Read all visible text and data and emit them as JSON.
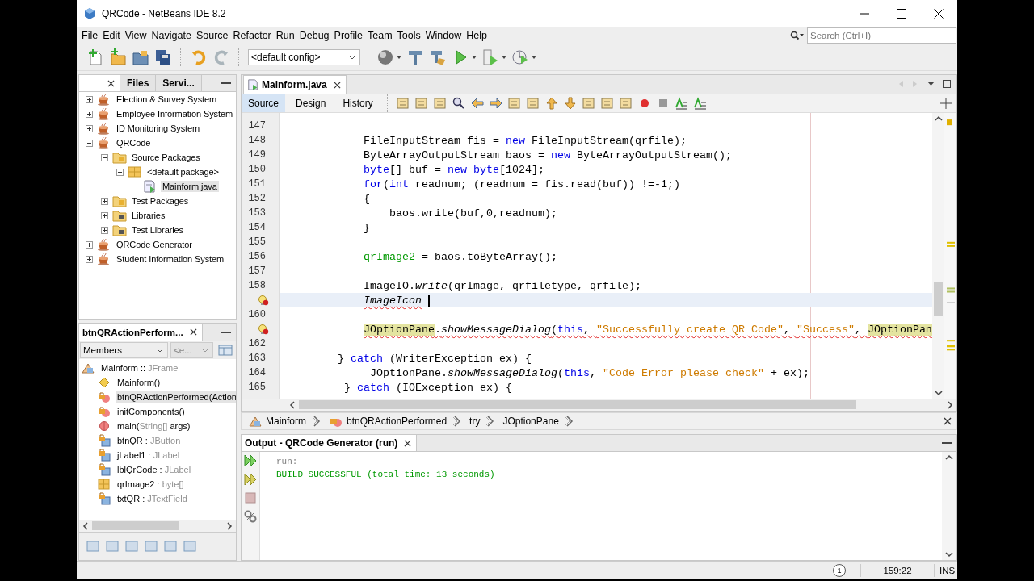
{
  "window": {
    "title": "QRCode - NetBeans IDE 8.2"
  },
  "menu": [
    "File",
    "Edit",
    "View",
    "Navigate",
    "Source",
    "Refactor",
    "Run",
    "Debug",
    "Profile",
    "Team",
    "Tools",
    "Window",
    "Help"
  ],
  "search": {
    "placeholder": "Search (Ctrl+I)"
  },
  "toolbar": {
    "config": "<default config>"
  },
  "projects": {
    "tabs": [
      {
        "selected": true
      },
      {
        "label": "Files",
        "selected": false
      },
      {
        "label": "Servi...",
        "selected": false
      }
    ],
    "tree": [
      {
        "label": "Election & Survey System",
        "kind": "project",
        "expanded": false,
        "selected": false
      },
      {
        "label": "Employee Information System",
        "kind": "project",
        "expanded": false,
        "selected": false
      },
      {
        "label": "ID Monitoring System",
        "kind": "project",
        "expanded": false,
        "selected": false
      },
      {
        "label": "QRCode",
        "kind": "project",
        "expanded": true,
        "selected": false,
        "children": [
          {
            "label": "Source Packages",
            "kind": "packages",
            "expanded": true,
            "selected": false,
            "children": [
              {
                "label": "<default package>",
                "kind": "package",
                "expanded": true,
                "selected": false,
                "children": [
                  {
                    "label": "Mainform.java",
                    "kind": "java-file",
                    "selected": true
                  }
                ]
              }
            ]
          },
          {
            "label": "Test Packages",
            "kind": "packages",
            "expanded": false,
            "selected": false
          },
          {
            "label": "Libraries",
            "kind": "libraries",
            "expanded": false,
            "selected": false
          },
          {
            "label": "Test Libraries",
            "kind": "libraries",
            "expanded": false,
            "selected": false
          }
        ]
      },
      {
        "label": "QRCode Generator",
        "kind": "project",
        "expanded": false,
        "selected": false
      },
      {
        "label": "Student Information System",
        "kind": "project",
        "expanded": false,
        "selected": false
      }
    ]
  },
  "navigator": {
    "title": "btnQRActionPerform...",
    "view": "Members",
    "filter": "<e...",
    "root": {
      "name": "Mainform :: ",
      "type": "JFrame",
      "kind": "class",
      "children": [
        {
          "name": "Mainform()",
          "kind": "constructor",
          "selected": false
        },
        {
          "name": "btnQRActionPerformed(Action",
          "kind": "private-method",
          "selected": true
        },
        {
          "name": "initComponents()",
          "kind": "private-method",
          "selected": false
        },
        {
          "name": "main(",
          "type": "String[]",
          "suffix": " args)",
          "kind": "static-method",
          "selected": false
        },
        {
          "name": "btnQR : ",
          "type": "JButton",
          "kind": "private-field",
          "selected": false
        },
        {
          "name": "jLabel1 : ",
          "type": "JLabel",
          "kind": "private-field",
          "selected": false
        },
        {
          "name": "lblQrCode : ",
          "type": "JLabel",
          "kind": "private-field",
          "selected": false
        },
        {
          "name": "qrImage2 : ",
          "type": "byte[]",
          "kind": "field",
          "selected": false
        },
        {
          "name": "txtQR : ",
          "type": "JTextField",
          "kind": "private-field",
          "selected": false
        }
      ]
    }
  },
  "editor": {
    "tab": {
      "label": "Mainform.java",
      "selected": true
    },
    "views": [
      {
        "label": "Source",
        "selected": true
      },
      {
        "label": "Design",
        "selected": false
      },
      {
        "label": "History",
        "selected": false
      }
    ],
    "lines": [
      {
        "number": "147"
      },
      {
        "number": "148",
        "tokens": [
          {
            "text": "            FileInputStream fis = ",
            "kind": "plain"
          },
          {
            "text": "new",
            "kind": "keyword"
          },
          {
            "text": " FileInputStream(qrfile);",
            "kind": "plain"
          }
        ]
      },
      {
        "number": "149",
        "tokens": [
          {
            "text": "            ByteArrayOutputStream baos = ",
            "kind": "plain"
          },
          {
            "text": "new",
            "kind": "keyword"
          },
          {
            "text": " ByteArrayOutputStream();",
            "kind": "plain"
          }
        ]
      },
      {
        "number": "150",
        "tokens": [
          {
            "text": "            byte",
            "kind": "keyword"
          },
          {
            "text": "[] buf = ",
            "kind": "plain"
          },
          {
            "text": "new",
            "kind": "keyword"
          },
          {
            "text": " byte",
            "kind": "keyword"
          },
          {
            "text": "[1024];",
            "kind": "plain"
          }
        ]
      },
      {
        "number": "151",
        "tokens": [
          {
            "text": "            for",
            "kind": "keyword"
          },
          {
            "text": "(",
            "kind": "plain"
          },
          {
            "text": "int",
            "kind": "keyword"
          },
          {
            "text": " readnum; (readnum = fis.read(buf)) !=-1;)",
            "kind": "plain"
          }
        ]
      },
      {
        "number": "152",
        "tokens": [
          {
            "text": "            {",
            "kind": "plain"
          }
        ]
      },
      {
        "number": "153",
        "tokens": [
          {
            "text": "                baos.write(buf,0,readnum);",
            "kind": "plain"
          }
        ]
      },
      {
        "number": "154",
        "tokens": [
          {
            "text": "            }",
            "kind": "plain"
          }
        ]
      },
      {
        "number": "155"
      },
      {
        "number": "156",
        "tokens": [
          {
            "text": "            qrImage2",
            "kind": "field"
          },
          {
            "text": " = baos.toByteArray();",
            "kind": "plain"
          }
        ]
      },
      {
        "number": "157"
      },
      {
        "number": "158",
        "tokens": [
          {
            "text": "            ImageIO.",
            "kind": "plain"
          },
          {
            "text": "write",
            "kind": "method"
          },
          {
            "text": "(qrImage, qrfiletype, qrfile);",
            "kind": "plain"
          }
        ]
      },
      {
        "current": true,
        "hint": true,
        "caret": true,
        "tokens": [
          {
            "text": "            ImageIcon",
            "kind": "unresolved"
          }
        ]
      },
      {
        "number": "160"
      },
      {
        "hint": true,
        "error": true,
        "tokens": [
          {
            "text": "            JOptionPane",
            "kind": "highlight"
          },
          {
            "text": ".",
            "kind": "plain"
          },
          {
            "text": "showMessageDialog",
            "kind": "method"
          },
          {
            "text": "(",
            "kind": "plain"
          },
          {
            "text": "this",
            "kind": "keyword"
          },
          {
            "text": ", ",
            "kind": "plain"
          },
          {
            "text": "\"Successfully create QR Code\"",
            "kind": "string"
          },
          {
            "text": ", ",
            "kind": "plain"
          },
          {
            "text": "\"Success\"",
            "kind": "string"
          },
          {
            "text": ", ",
            "kind": "plain"
          },
          {
            "text": "JOptionPan",
            "kind": "highlight"
          }
        ]
      },
      {
        "number": "162"
      },
      {
        "number": "163",
        "tokens": [
          {
            "text": "        } ",
            "kind": "plain"
          },
          {
            "text": "catch",
            "kind": "keyword"
          },
          {
            "text": " (WriterException ex) {",
            "kind": "plain"
          }
        ]
      },
      {
        "number": "164",
        "tokens": [
          {
            "text": "             JOptionPane.",
            "kind": "plain"
          },
          {
            "text": "showMessageDialog",
            "kind": "method"
          },
          {
            "text": "(",
            "kind": "plain"
          },
          {
            "text": "this",
            "kind": "keyword"
          },
          {
            "text": ", ",
            "kind": "plain"
          },
          {
            "text": "\"Code Error please check\"",
            "kind": "string"
          },
          {
            "text": " + ex);",
            "kind": "plain"
          }
        ]
      },
      {
        "number": "165",
        "tokens": [
          {
            "text": "         } ",
            "kind": "plain"
          },
          {
            "text": "catch",
            "kind": "keyword"
          },
          {
            "text": " (IOException ex) {",
            "kind": "plain"
          }
        ]
      }
    ]
  },
  "breadcrumb": [
    {
      "label": "Mainform",
      "kind": "class"
    },
    {
      "label": "btnQRActionPerformed",
      "kind": "method"
    },
    {
      "label": "try",
      "kind": "plain"
    },
    {
      "label": "JOptionPane",
      "kind": "plain"
    }
  ],
  "output": {
    "title": "Output - QRCode Generator (run)",
    "lines": [
      {
        "text": "run:",
        "kind": "info"
      },
      {
        "text": "BUILD SUCCESSFUL (total time: 13 seconds)",
        "kind": "success"
      }
    ]
  },
  "status": {
    "notifications": "1",
    "position": "159:22",
    "mode": "INS"
  }
}
